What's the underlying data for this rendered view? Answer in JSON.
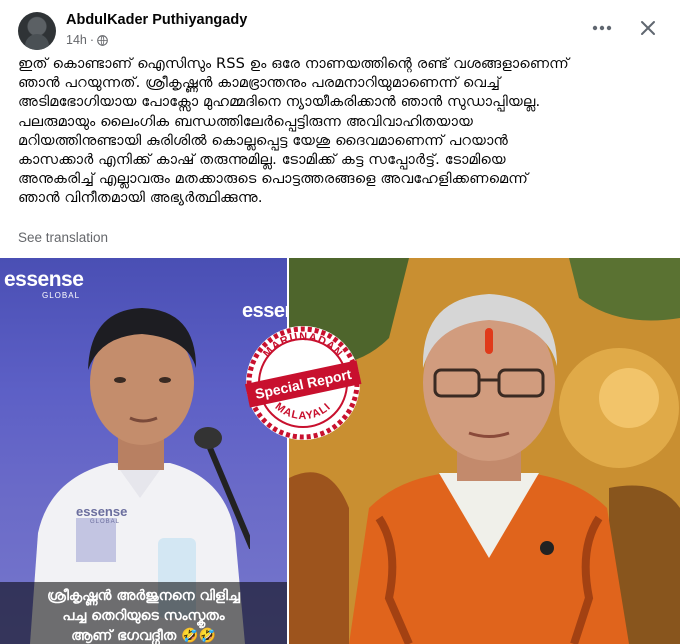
{
  "header": {
    "author": "AbdulKader Puthiyangady",
    "time": "14h",
    "time_separator": "·"
  },
  "post": {
    "lines": [
      "ഇത് കൊണ്ടാണ് ഐസിസും RSS ഉം ഒരേ നാണയത്തിന്റെ രണ്ട് വശങ്ങളാണെന്ന്",
      "ഞാൻ പറയുന്നത്. ശ്രീകൃഷ്ണൻ കാമഭ്രാന്തനും പരമനാറിയുമാണെന്ന് വെച്ച്",
      "അടിമഭോഗിയായ പോക്സോ മുഹമ്മദിനെ ന്യായീകരിക്കാൻ ഞാൻ സുഡാപ്പിയല്ല.",
      "പലരുമായും ലൈംഗിക ബന്ധത്തിലേർപ്പെട്ടിരുന്ന അവിവാഹിതയായ",
      "മറിയത്തിനുണ്ടായി കുരിശിൽ കൊല്ലപ്പെട്ട യേശു ദൈവമാണെന്ന് പറയാൻ",
      "കാസക്കാർ എനിക്ക് കാഷ് തരുന്നുമില്ല. ടോമിക്ക് കട്ട സപ്പോർട്ട്. ടോമിയെ",
      "അനുകരിച്ച് എല്ലാവരും മതക്കാരുടെ പൊട്ടത്തരങ്ങളെ അവഹേളിക്കണമെന്ന്",
      "ഞാൻ വിനീതമായി അഭ്യർത്ഥിക്കുന്നു."
    ],
    "see_translation": "See translation"
  },
  "media": {
    "left_logo_top": "essense",
    "left_logo_top_sub": "GLOBAL",
    "left_logo_side": "essense",
    "left_logo_small": "essense",
    "left_logo_small_sub": "GLOBAL",
    "caption_line1": "ശ്രീകൃഷ്ണൻ അർജുനനെ വിളിച്ച",
    "caption_line2": "പച്ച തെറിയുടെ സംസ്കൃതം",
    "caption_line3": "ആണ് ഭഗവദ്ഗീത 🤣🤣",
    "stamp_top": "MARUNADAN",
    "stamp_main": "Special Report",
    "stamp_bottom": "MALAYALI"
  },
  "icons": {
    "more": "more-horizontal-icon",
    "close": "close-icon",
    "globe": "globe-icon"
  },
  "colors": {
    "meta_gray": "#65676b",
    "stamp_red": "#c8102e",
    "left_bg": "#5d60c6",
    "robe_orange": "#e0641c"
  }
}
